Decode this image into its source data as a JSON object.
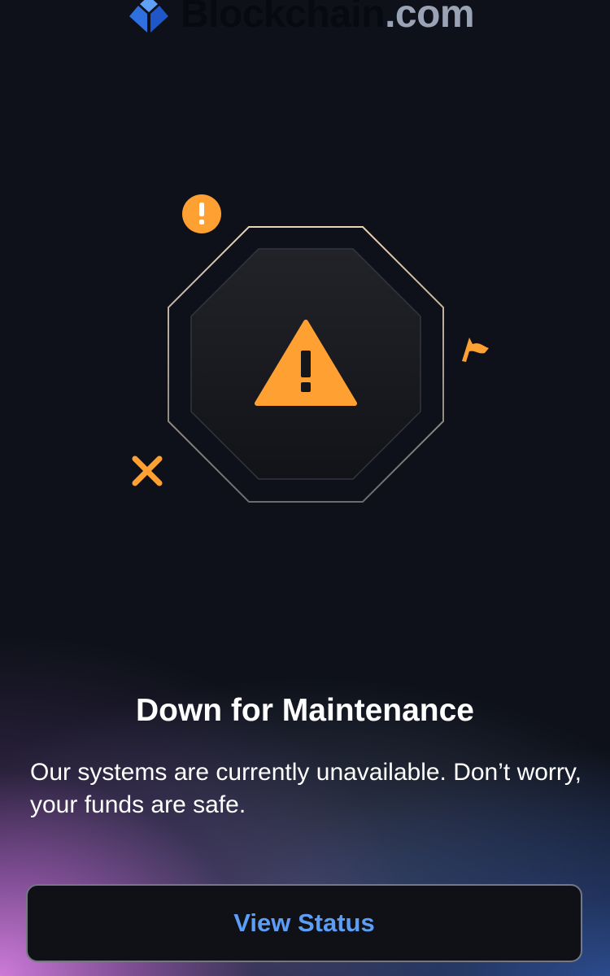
{
  "header": {
    "brand_main": "Blockchain",
    "brand_suffix": ".com",
    "logo_icon": "blockchain-logo-icon"
  },
  "illustration": {
    "main_icon": "warning-triangle-icon",
    "decor_icons": [
      "exclamation-circle-icon",
      "flag-icon",
      "x-mark-icon"
    ],
    "accent_color": "#ffa033",
    "outline_color": "#e9d3b3"
  },
  "message": {
    "title": "Down for Maintenance",
    "body": "Our systems are currently unavailable. Don’t worry, your funds are safe."
  },
  "actions": {
    "view_status_label": "View Status",
    "view_status_color": "#5c9df5"
  },
  "colors": {
    "background": "#0e1119",
    "gradient_pink": "#d680e1",
    "gradient_blue": "#325aaa"
  }
}
